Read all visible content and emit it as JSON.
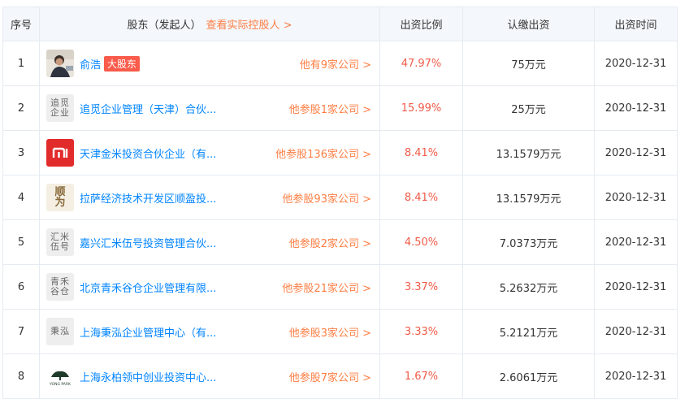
{
  "headers": {
    "seq": "序号",
    "holder": "股东（发起人）",
    "controller_link": "查看实际控股人 >",
    "ratio": "出资比例",
    "amount": "认缴出资",
    "date": "出资时间"
  },
  "rows": [
    {
      "seq": "1",
      "logo": "avatar-photo",
      "name": "俞浩",
      "badge": "大股东",
      "link": "他有9家公司 >",
      "ratio": "47.97%",
      "amount": "75万元",
      "date": "2020-12-31"
    },
    {
      "seq": "2",
      "logo": "追觅企业",
      "name": "追觅企业管理（天津）合伙...",
      "link": "他参股1家公司 >",
      "ratio": "15.99%",
      "amount": "25万元",
      "date": "2020-12-31"
    },
    {
      "seq": "3",
      "logo": "mi-logo",
      "name": "天津金米投资合伙企业（有...",
      "link": "他参股136家公司 >",
      "ratio": "8.41%",
      "amount": "13.1579万元",
      "date": "2020-12-31"
    },
    {
      "seq": "4",
      "logo": "shunwei-logo",
      "name": "拉萨经济技术开发区顺盈投...",
      "link": "他参股93家公司 >",
      "ratio": "8.41%",
      "amount": "13.1579万元",
      "date": "2020-12-31"
    },
    {
      "seq": "5",
      "logo": "汇米伍号",
      "name": "嘉兴汇米伍号投资管理合伙...",
      "link": "他参股2家公司 >",
      "ratio": "4.50%",
      "amount": "7.0373万元",
      "date": "2020-12-31"
    },
    {
      "seq": "6",
      "logo": "青禾谷仓",
      "name": "北京青禾谷仓企业管理有限...",
      "link": "他参股21家公司 >",
      "ratio": "3.37%",
      "amount": "5.2632万元",
      "date": "2020-12-31"
    },
    {
      "seq": "7",
      "logo": "秉泓",
      "name": "上海秉泓企业管理中心（有...",
      "link": "他参股3家公司 >",
      "ratio": "3.33%",
      "amount": "5.2121万元",
      "date": "2020-12-31"
    },
    {
      "seq": "8",
      "logo": "yongbai-logo",
      "name": "上海永柏领中创业投资中心...",
      "link": "他参股7家公司 >",
      "ratio": "1.67%",
      "amount": "2.6061万元",
      "date": "2020-12-31"
    }
  ],
  "logo_text": {
    "r2": [
      "追觅",
      "企业"
    ],
    "r5": [
      "汇米",
      "伍号"
    ],
    "r6": [
      "青禾",
      "谷仓"
    ],
    "r7": [
      "秉泓"
    ],
    "r4": [
      "顺",
      "为"
    ],
    "r8": "YONG PARK"
  },
  "colors": {
    "link_blue": "#0084ff",
    "link_orange": "#fd7e43",
    "percent_red": "#f05b48",
    "badge_red": "#fb5b4a",
    "header_bg": "#f4f7fc",
    "mi_red": "#e22b2b"
  }
}
